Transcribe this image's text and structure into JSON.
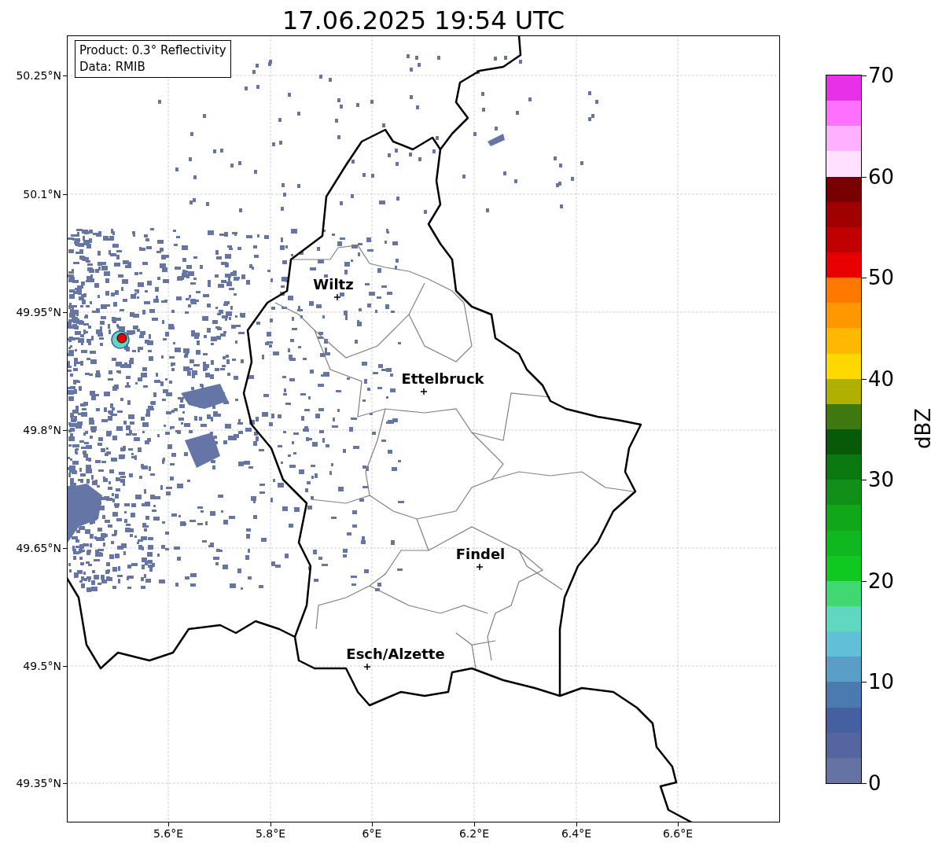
{
  "title": "17.06.2025 19:54 UTC",
  "info_box": [
    "Product: 0.3° Reflectivity",
    "Data: RMIB"
  ],
  "lat_ticks": [
    "50.25°N",
    "50.1°N",
    "49.95°N",
    "49.8°N",
    "49.65°N",
    "49.5°N",
    "49.35°N"
  ],
  "lon_ticks": [
    "5.6°E",
    "5.8°E",
    "6°E",
    "6.2°E",
    "6.4°E",
    "6.6°E"
  ],
  "cities": [
    {
      "name": "Wiltz"
    },
    {
      "name": "Ettelbruck"
    },
    {
      "name": "Findel"
    },
    {
      "name": "Esch/Alzette"
    }
  ],
  "colorbar": {
    "label": "dBZ",
    "ticks": [
      "70",
      "60",
      "50",
      "40",
      "30",
      "20",
      "10",
      "0"
    ],
    "bands": [
      {
        "color": "#e830e8"
      },
      {
        "color": "#ff70ff"
      },
      {
        "color": "#ffb0ff"
      },
      {
        "color": "#ffe0ff"
      },
      {
        "color": "#780000"
      },
      {
        "color": "#a00000"
      },
      {
        "color": "#c00000"
      },
      {
        "color": "#e80000"
      },
      {
        "color": "#ff7800"
      },
      {
        "color": "#ff9800"
      },
      {
        "color": "#ffb800"
      },
      {
        "color": "#ffd800"
      },
      {
        "color": "#b0b000"
      },
      {
        "color": "#407810"
      },
      {
        "color": "#085a08"
      },
      {
        "color": "#0c7810"
      },
      {
        "color": "#109018"
      },
      {
        "color": "#10a818"
      },
      {
        "color": "#10b820"
      },
      {
        "color": "#10c820"
      },
      {
        "color": "#40d870"
      },
      {
        "color": "#60d8c0"
      },
      {
        "color": "#60c0d8"
      },
      {
        "color": "#5a9ec8"
      },
      {
        "color": "#4a7ab0"
      },
      {
        "color": "#4560a0"
      },
      {
        "color": "#5565a0"
      },
      {
        "color": "#6472a4"
      }
    ]
  }
}
